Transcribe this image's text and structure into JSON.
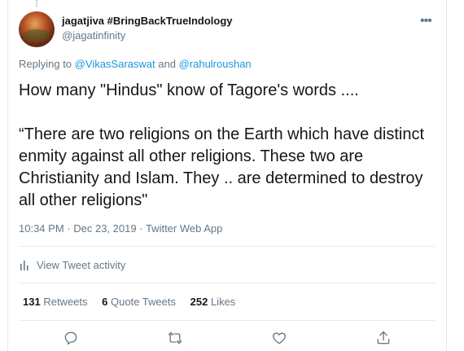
{
  "tweet": {
    "display_name": "jagatjiva #BringBackTrueIndology",
    "handle": "@jagatinfinity",
    "reply_prefix": "Replying to",
    "reply_mentions": [
      "@VikasSaraswat",
      "@rahulroushan"
    ],
    "reply_and": "and",
    "text_line_1": "How many \"Hindus\" know of Tagore's words ....",
    "text_line_2": "“There are two religions on the Earth which have distinct enmity against all other religions. These two are Christianity and Islam. They .. are determined to destroy all other religions\"",
    "time": "10:34 PM",
    "date": "Dec 23, 2019",
    "source": "Twitter Web App",
    "separator": "·"
  },
  "activity": {
    "label": "View Tweet activity",
    "icon": "bar-chart-icon"
  },
  "stats": {
    "retweets_count": "131",
    "retweets_label": "Retweets",
    "quotes_count": "6",
    "quotes_label": "Quote Tweets",
    "likes_count": "252",
    "likes_label": "Likes"
  },
  "actions": {
    "reply_icon": "reply-icon",
    "retweet_icon": "retweet-icon",
    "like_icon": "heart-icon",
    "share_icon": "share-icon"
  },
  "colors": {
    "link": "#1b95e0",
    "secondary": "#657786",
    "text": "#14171a"
  }
}
